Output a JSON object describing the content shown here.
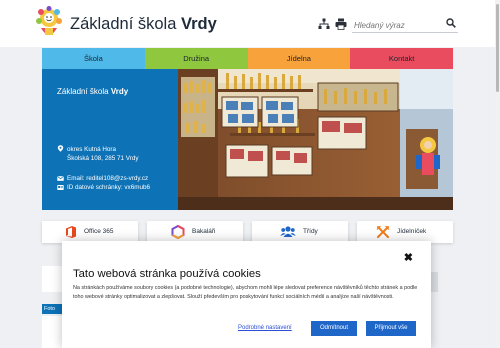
{
  "header": {
    "title_prefix": "Základní škola",
    "title_strong": "Vrdy",
    "search_placeholder": "Hledaný výraz",
    "icons": [
      "sitemap-icon",
      "print-icon",
      "search-icon"
    ]
  },
  "nav": {
    "items": [
      {
        "label": "Škola",
        "color": "#4fb9e9"
      },
      {
        "label": "Družina",
        "color": "#8fc73e"
      },
      {
        "label": "Jídelna",
        "color": "#f7a23a"
      },
      {
        "label": "Kontakt",
        "color": "#e84c5e"
      }
    ]
  },
  "hero": {
    "title_prefix": "Základní škola",
    "title_strong": "Vrdy",
    "address_line1": "okres Kutná Hora",
    "address_line2": "Školská 108, 285 71 Vrdy",
    "email": "Email: reditel108@zs-vrdy.cz",
    "data_box": "ID datové schránky: vx6mub6",
    "colors": {
      "panel": "#0d72b6"
    }
  },
  "quick_links": [
    {
      "label": "Office 365",
      "icon": "office-icon",
      "color": "#e8491e"
    },
    {
      "label": "Bakaláři",
      "icon": "bakalari-icon",
      "color": "#7b4bd1"
    },
    {
      "label": "Třídy",
      "icon": "people-icon",
      "color": "#1f66c9"
    },
    {
      "label": "Jídelníček",
      "icon": "cutlery-icon",
      "color": "#f07b1a"
    }
  ],
  "below": {
    "tag_label": "Foto"
  },
  "cookie": {
    "title": "Tato webová stránka používá cookies",
    "text": "Na stránkách používáme soubory cookies (a podobné technologie), abychom mohli lépe sledovat preference návštěvníků těchto stránek a podle toho webové stránky optimalizovat a zlepšovat. Slouží především pro poskytování funkcí sociálních médií a analýze naší návštěvnosti.",
    "settings_link": "Podrobné nastavení",
    "reject_label": "Odmítnout",
    "accept_label": "Přijmout vše",
    "close_symbol": "✖",
    "colors": {
      "button": "#1f66c9",
      "link": "#2d4fd6"
    }
  }
}
